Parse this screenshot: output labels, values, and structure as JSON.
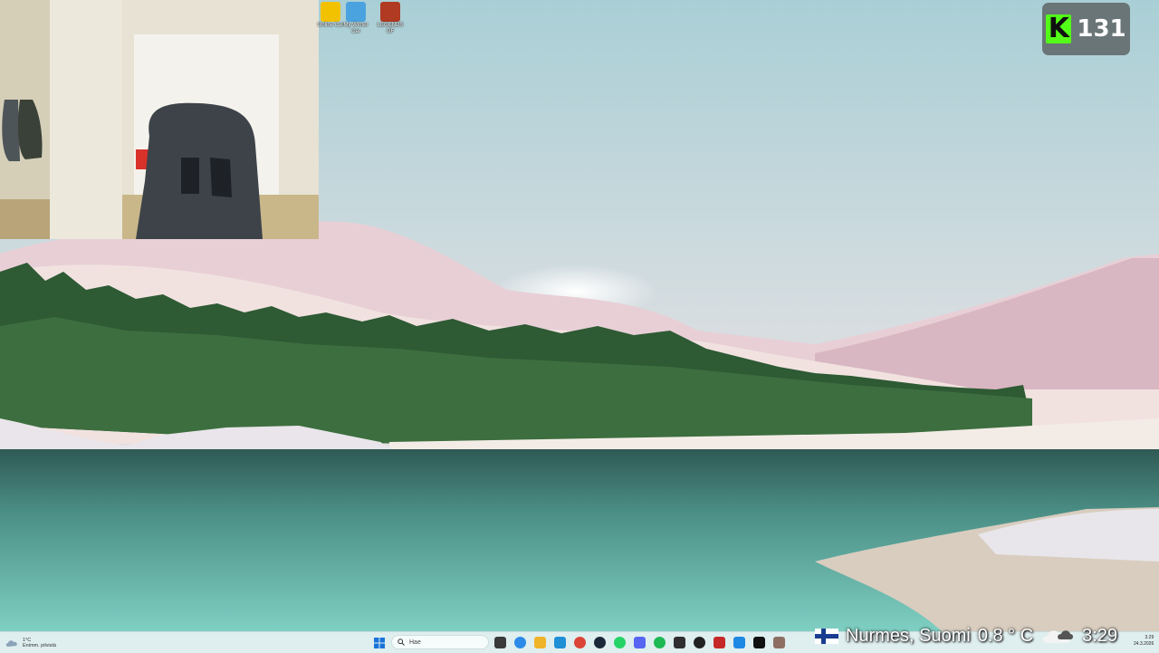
{
  "desktop_icons": [
    {
      "name": "rooster-teeth-icon",
      "label": "Online Car",
      "color": "#f2c200"
    },
    {
      "name": "my-winter-car-icon",
      "label": "My Winter Car",
      "color": "#4aa3df"
    },
    {
      "name": "game-shortcut-icon",
      "label": "LEGENDS OF",
      "color": "#b03a22"
    }
  ],
  "kick": {
    "letter": "K",
    "viewers": "131",
    "color": "#53fc18"
  },
  "taskbar": {
    "weather_temp": "1°C",
    "weather_desc": "Enimm. pilvistä",
    "search_placeholder": "Hae",
    "apps": [
      {
        "name": "task-view-icon",
        "color": "#3a3a3a"
      },
      {
        "name": "copilot-icon",
        "color": "#2c8be8"
      },
      {
        "name": "file-explorer-icon",
        "color": "#f0b429"
      },
      {
        "name": "edge-icon",
        "color": "#1f8fd6"
      },
      {
        "name": "chrome-icon",
        "color": "#db4437"
      },
      {
        "name": "steam-icon",
        "color": "#1b2838"
      },
      {
        "name": "whatsapp-icon",
        "color": "#25d366"
      },
      {
        "name": "discord-icon",
        "color": "#5865f2"
      },
      {
        "name": "spotify-icon",
        "color": "#1db954"
      },
      {
        "name": "obs-icon",
        "color": "#302e31"
      },
      {
        "name": "app-k-icon",
        "color": "#222222"
      },
      {
        "name": "game-icon",
        "color": "#c62828"
      },
      {
        "name": "app-blue-icon",
        "color": "#1e88e5"
      },
      {
        "name": "capcut-icon",
        "color": "#111111"
      },
      {
        "name": "app-extra-icon",
        "color": "#8d6e63"
      }
    ],
    "clock_time": "3.29",
    "clock_date": "24.3.2026"
  },
  "stream_overlay": {
    "location": "Nurmes, Suomi",
    "temperature": "0.8 ° C",
    "time": "3:29"
  }
}
